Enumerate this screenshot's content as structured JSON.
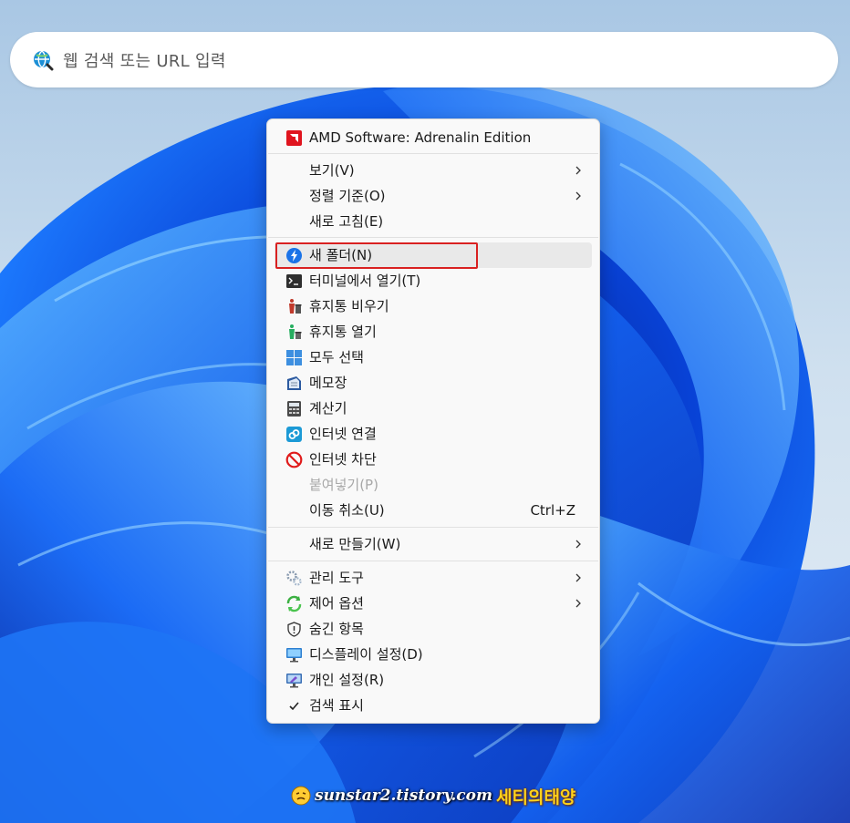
{
  "search": {
    "placeholder": "웹 검색 또는 URL 입력"
  },
  "menu": {
    "items": [
      {
        "label": "AMD Software: Adrenalin Edition",
        "icon": "amd-logo-icon"
      },
      {
        "label": "보기(V)",
        "submenu": true
      },
      {
        "label": "정렬 기준(O)",
        "submenu": true
      },
      {
        "label": "새로 고침(E)"
      },
      {
        "label": "새 폴더(N)",
        "icon": "new-folder-icon"
      },
      {
        "label": "터미널에서 열기(T)",
        "icon": "terminal-icon"
      },
      {
        "label": "휴지통 비우기",
        "icon": "empty-recycle-bin-icon"
      },
      {
        "label": "휴지통 열기",
        "icon": "recycle-bin-icon"
      },
      {
        "label": "모두 선택",
        "icon": "select-all-icon"
      },
      {
        "label": "메모장",
        "icon": "notepad-icon"
      },
      {
        "label": "계산기",
        "icon": "calculator-icon"
      },
      {
        "label": "인터넷 연결",
        "icon": "internet-connect-icon"
      },
      {
        "label": "인터넷 차단",
        "icon": "internet-block-icon"
      },
      {
        "label": "붙여넣기(P)",
        "disabled": true
      },
      {
        "label": "이동 취소(U)",
        "shortcut": "Ctrl+Z"
      },
      {
        "label": "새로 만들기(W)",
        "submenu": true
      },
      {
        "label": "관리 도구",
        "icon": "admin-tools-icon",
        "submenu": true
      },
      {
        "label": "제어 옵션",
        "icon": "control-options-icon",
        "submenu": true
      },
      {
        "label": "숨긴 항목",
        "icon": "shield-icon"
      },
      {
        "label": "디스플레이 설정(D)",
        "icon": "display-icon"
      },
      {
        "label": "개인 설정(R)",
        "icon": "personalize-icon"
      },
      {
        "label": "검색 표시",
        "icon": "checkmark-icon"
      }
    ]
  },
  "watermark": {
    "site": "sunstar2.tistory.com",
    "brand": "세티의태양"
  },
  "colors": {
    "accent_blue": "#0a5ae8",
    "highlight_red": "#d92121",
    "menu_bg": "#f9f9f9"
  }
}
